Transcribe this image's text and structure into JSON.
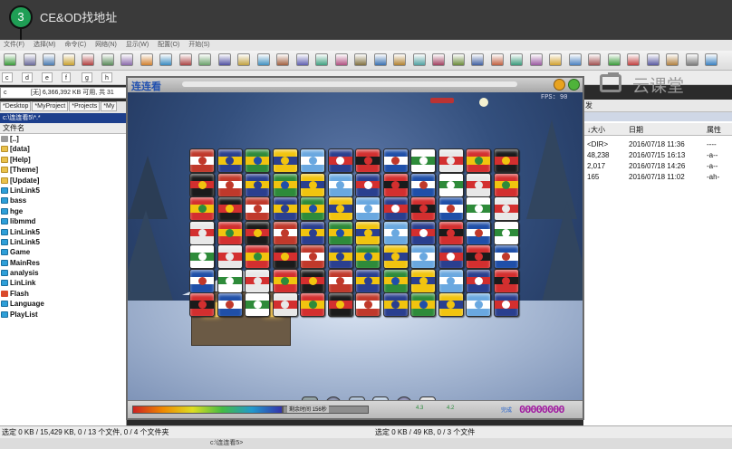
{
  "overlay": {
    "step_number": "3",
    "title": "CE&OD找地址"
  },
  "menubar": {
    "items": [
      "文件(F)",
      "选择(M)",
      "命令(C)",
      "网络(N)",
      "显示(W)",
      "配置(O)",
      "开始(S)"
    ]
  },
  "drives": {
    "items": [
      "c",
      "d",
      "e",
      "f",
      "g",
      "h"
    ]
  },
  "left_panel": {
    "drive_combo": "c",
    "free_space": "[无] 6,366,392 KB 可用, 共 31",
    "tabs": [
      "*Desktop",
      "*MyProject",
      "*Projects",
      "*My"
    ],
    "path": "c:\\连连看5\\*.*",
    "column_header": "文件名",
    "files": [
      {
        "name": "[..]",
        "icon": "up-icon"
      },
      {
        "name": "[data]",
        "icon": "folder-icon"
      },
      {
        "name": "[Help]",
        "icon": "folder-icon"
      },
      {
        "name": "[Theme]",
        "icon": "folder-icon"
      },
      {
        "name": "[Update]",
        "icon": "folder-icon"
      },
      {
        "name": "LinLink5",
        "icon": "exe-icon"
      },
      {
        "name": "bass",
        "icon": "dll-icon"
      },
      {
        "name": "hge",
        "icon": "dll-icon"
      },
      {
        "name": "libmmd",
        "icon": "dll-icon"
      },
      {
        "name": "LinLink5",
        "icon": "exe-icon"
      },
      {
        "name": "LinLink5",
        "icon": "exe-icon"
      },
      {
        "name": "Game",
        "icon": "exe-icon"
      },
      {
        "name": "MainRes",
        "icon": "file-icon"
      },
      {
        "name": "analysis",
        "icon": "file-icon"
      },
      {
        "name": "LinLink",
        "icon": "file-icon"
      },
      {
        "name": "Flash",
        "icon": "flash-icon"
      },
      {
        "name": "Language",
        "icon": "file-icon"
      },
      {
        "name": "PlayList",
        "icon": "file-icon"
      }
    ]
  },
  "right_panel": {
    "tab_label": "发",
    "columns": {
      "size": "↓大小",
      "date": "日期",
      "attr": "属性"
    },
    "rows": [
      {
        "size": "<DIR>",
        "date": "2016/07/18 11:36",
        "attr": "----"
      },
      {
        "size": "48,238",
        "date": "2016/07/15 16:13",
        "attr": "-a--"
      },
      {
        "size": "2,017",
        "date": "2016/07/18 14:26",
        "attr": "-a--"
      },
      {
        "size": "165",
        "date": "2016/07/18 11:02",
        "attr": "-ah-"
      }
    ]
  },
  "watermark": {
    "text": "云课堂"
  },
  "game_window": {
    "logo": "连连看",
    "fps": "FPS: 90",
    "time_label": "剩余时间",
    "time_value": "156秒",
    "stat_a": "4.3",
    "stat_b": "4.2",
    "score_label": "完成",
    "score": "00000000",
    "tile_rows": 7,
    "tile_cols": 12
  },
  "statusbar": {
    "left": "选定 0 KB / 15,429 KB, 0 / 13 个文件, 0 / 4 个文件夹",
    "right": "选定 0 KB / 49 KB, 0 / 3 个文件"
  },
  "command_line": "c:\\连连看5>",
  "colors": {
    "badge": "#1f9e55",
    "path_bar": "#1d3f8c",
    "score": "#a018a0"
  }
}
